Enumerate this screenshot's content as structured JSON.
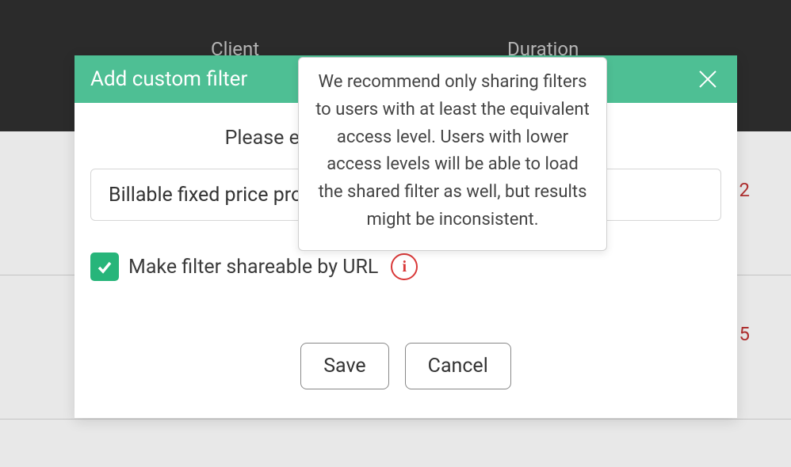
{
  "background": {
    "header_client": "Client",
    "header_duration": "Duration",
    "row_values": [
      "2",
      "5"
    ]
  },
  "modal": {
    "title": "Add custom filter",
    "prompt": "Please enter a name for the custom filter.",
    "input_value": "Billable fixed price projects",
    "share_label": "Make filter shareable by URL",
    "share_checked": true,
    "save_label": "Save",
    "cancel_label": "Cancel"
  },
  "tooltip": {
    "text": "We recommend only sharing filters to users with at least the equivalent access level. Users with lower access levels will be able to load the shared filter as well, but results might be inconsistent."
  }
}
